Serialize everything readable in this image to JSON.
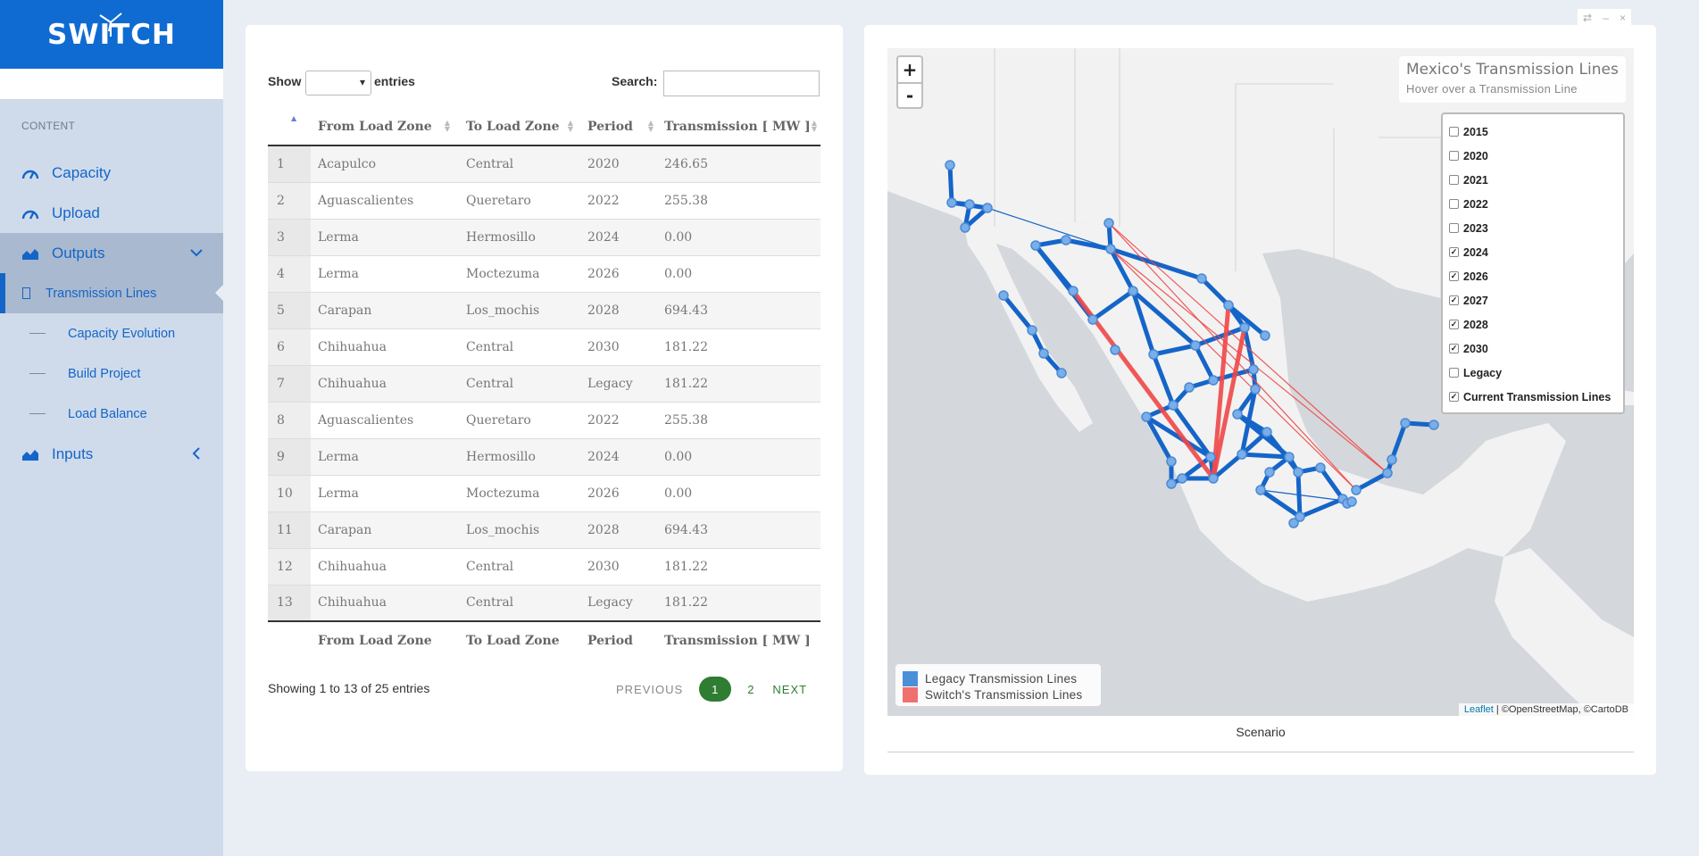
{
  "sidebar": {
    "brand": "SWITCH",
    "section": "CONTENT",
    "nav": [
      {
        "label": "Capacity"
      },
      {
        "label": "Upload"
      },
      {
        "label": "Outputs"
      }
    ],
    "subnav": [
      {
        "label": "Transmission Lines"
      },
      {
        "label": "Capacity Evolution"
      },
      {
        "label": "Build Project"
      },
      {
        "label": "Load Balance"
      }
    ],
    "inputs": "Inputs",
    "accent": "#0f6bd1"
  },
  "table": {
    "show_label": "Show",
    "entries_label": "entries",
    "search_label": "Search:",
    "columns": [
      "From Load Zone",
      "To Load Zone",
      "Period",
      "Transmission [ MW ]"
    ],
    "rows": [
      [
        "1",
        "Acapulco",
        "Central",
        "2020",
        "246.65"
      ],
      [
        "2",
        "Aguascalientes",
        "Queretaro",
        "2022",
        "255.38"
      ],
      [
        "3",
        "Lerma",
        "Hermosillo",
        "2024",
        "0.00"
      ],
      [
        "4",
        "Lerma",
        "Moctezuma",
        "2026",
        "0.00"
      ],
      [
        "5",
        "Carapan",
        "Los_mochis",
        "2028",
        "694.43"
      ],
      [
        "6",
        "Chihuahua",
        "Central",
        "2030",
        "181.22"
      ],
      [
        "7",
        "Chihuahua",
        "Central",
        "Legacy",
        "181.22"
      ],
      [
        "8",
        "Aguascalientes",
        "Queretaro",
        "2022",
        "255.38"
      ],
      [
        "9",
        "Lerma",
        "Hermosillo",
        "2024",
        "0.00"
      ],
      [
        "10",
        "Lerma",
        "Moctezuma",
        "2026",
        "0.00"
      ],
      [
        "11",
        "Carapan",
        "Los_mochis",
        "2028",
        "694.43"
      ],
      [
        "12",
        "Chihuahua",
        "Central",
        "2030",
        "181.22"
      ],
      [
        "13",
        "Chihuahua",
        "Central",
        "Legacy",
        "181.22"
      ]
    ],
    "info": "Showing 1 to 13 of 25 entries",
    "pager": {
      "previous": "PREVIOUS",
      "pages": [
        "1",
        "2"
      ],
      "next": "NEXT"
    }
  },
  "map": {
    "title": "Mexico's Transmission Lines",
    "subtitle": "Hover over a Transmission Line",
    "zoom_in": "+",
    "zoom_out": "-",
    "layers": [
      {
        "label": "2015",
        "checked": false
      },
      {
        "label": "2020",
        "checked": false
      },
      {
        "label": "2021",
        "checked": false
      },
      {
        "label": "2022",
        "checked": false
      },
      {
        "label": "2023",
        "checked": false
      },
      {
        "label": "2024",
        "checked": true
      },
      {
        "label": "2026",
        "checked": true
      },
      {
        "label": "2027",
        "checked": true
      },
      {
        "label": "2028",
        "checked": true
      },
      {
        "label": "2030",
        "checked": true
      },
      {
        "label": "Legacy",
        "checked": false
      },
      {
        "label": "Current Transmission Lines",
        "checked": true
      }
    ],
    "legend": [
      {
        "label": "Legacy Transmission Lines",
        "color": "#4a90d9"
      },
      {
        "label": "Switch's Transmission Lines",
        "color": "#f07070"
      }
    ],
    "attribution_link": "Leaflet",
    "attribution_rest": " | ©OpenStreetMap, ©CartoDB",
    "legacy_color": "#1565c8",
    "switch_color": "#f04848"
  },
  "scenario_label": "Scenario"
}
